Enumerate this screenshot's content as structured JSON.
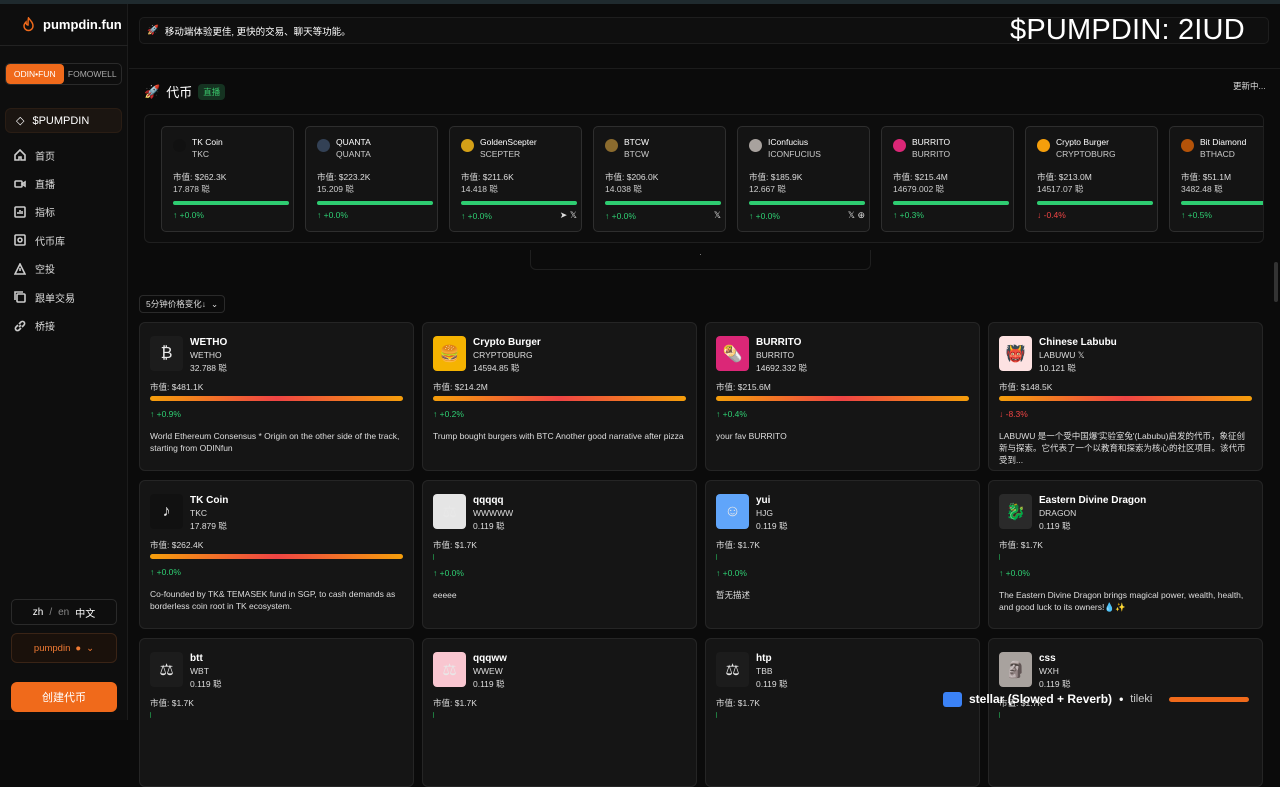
{
  "app": {
    "name": "pumpdin.fun",
    "overlay_text": "$PUMPDIN: 2IUD"
  },
  "sidebar": {
    "tabs": [
      "ODIN•FUN",
      "FOMOWELL"
    ],
    "current_token": "$PUMPDIN",
    "items": [
      {
        "label": "首页",
        "icon": "home-icon"
      },
      {
        "label": "直播",
        "icon": "video-icon"
      },
      {
        "label": "指标",
        "icon": "chart-icon"
      },
      {
        "label": "代币库",
        "icon": "vault-icon"
      },
      {
        "label": "空投",
        "icon": "airdrop-icon"
      },
      {
        "label": "跟单交易",
        "icon": "copy-icon"
      },
      {
        "label": "桥接",
        "icon": "link-icon"
      }
    ],
    "lang": {
      "zh": "zh",
      "sep": "/",
      "en": "en",
      "cn": "中文"
    },
    "user": "pumpdin",
    "create_label": "创建代币"
  },
  "announcement": "移动端体验更佳, 更快的交易、聊天等功能。",
  "section": {
    "title": "代币",
    "live_badge": "直播",
    "updating": "更新中..."
  },
  "ticker": [
    {
      "name": "TK Coin",
      "symbol": "TKC",
      "mcap": "市值: $262.3K",
      "holders": "17.878 聪",
      "change": "↑ +0.0%",
      "dir": "up",
      "color": "#111",
      "social": ""
    },
    {
      "name": "QUANTA",
      "symbol": "QUANTA",
      "mcap": "市值: $223.2K",
      "holders": "15.209 聪",
      "change": "↑ +0.0%",
      "dir": "up",
      "color": "#334155",
      "social": ""
    },
    {
      "name": "GoldenScepter",
      "symbol": "SCEPTER",
      "mcap": "市值: $211.6K",
      "holders": "14.418 聪",
      "change": "↑ +0.0%",
      "dir": "up",
      "color": "#d4a017",
      "social": "➤ 𝕏"
    },
    {
      "name": "BTCW",
      "symbol": "BTCW",
      "mcap": "市值: $206.0K",
      "holders": "14.038 聪",
      "change": "↑ +0.0%",
      "dir": "up",
      "color": "#8b6b2e",
      "social": "𝕏"
    },
    {
      "name": "IConfucius",
      "symbol": "ICONFUCIUS",
      "mcap": "市值: $185.9K",
      "holders": "12.667 聪",
      "change": "↑ +0.0%",
      "dir": "up",
      "color": "#a8a29e",
      "social": "𝕏 ⊕"
    },
    {
      "name": "BURRITO",
      "symbol": "BURRITO",
      "mcap": "市值: $215.4M",
      "holders": "14679.002 聪",
      "change": "↑ +0.3%",
      "dir": "up",
      "color": "#db2777",
      "social": ""
    },
    {
      "name": "Crypto Burger",
      "symbol": "CRYPTOBURG",
      "mcap": "市值: $213.0M",
      "holders": "14517.07 聪",
      "change": "↓ -0.4%",
      "dir": "dn",
      "color": "#f59e0b",
      "social": ""
    },
    {
      "name": "Bit Diamond",
      "symbol": "BTHACD",
      "mcap": "市值: $51.1M",
      "holders": "3482.48 聪",
      "change": "↑ +0.5%",
      "dir": "up",
      "color": "#b45309",
      "social": ""
    }
  ],
  "carousel_dot": "·",
  "sort_label": "5分钟价格变化↓",
  "cards": [
    {
      "name": "WETHO",
      "symbol": "WETHO",
      "holders": "32.788 聪",
      "mcap": "市值: $481.1K",
      "change": "↑ +0.9%",
      "dir": "up",
      "bar": "grad",
      "desc": "World Ethereum Consensus * Origin on the other side of the track, starting from ODINfun",
      "icon": "₿",
      "bg": "#1c1c1c"
    },
    {
      "name": "Crypto Burger",
      "symbol": "CRYPTOBURG",
      "holders": "14594.85 聪",
      "mcap": "市值: $214.2M",
      "change": "↑ +0.2%",
      "dir": "up",
      "bar": "grad",
      "desc": "Trump bought burgers with BTC Another good narrative after pizza",
      "icon": "🍔",
      "bg": "#f5b301"
    },
    {
      "name": "BURRITO",
      "symbol": "BURRITO",
      "holders": "14692.332 聪",
      "mcap": "市值: $215.6M",
      "change": "↑ +0.4%",
      "dir": "up",
      "bar": "grad",
      "desc": "your fav BURRITO",
      "icon": "🌯",
      "bg": "#db2777"
    },
    {
      "name": "Chinese Labubu",
      "symbol": "LABUWU",
      "holders": "10.121 聪",
      "mcap": "市值: $148.5K",
      "change": "↓ -8.3%",
      "dir": "dn",
      "bar": "grad",
      "desc": "LABUWU 是一个受中国爆'实验室兔'(Labubu)启发的代币，象征创新与探索。它代表了一个以教育和探索为核心的社区项目。该代币受到...",
      "icon": "👹",
      "bg": "#fde2e2",
      "x": "𝕏"
    },
    {
      "name": "TK Coin",
      "symbol": "TKC",
      "holders": "17.879 聪",
      "mcap": "市值: $262.4K",
      "change": "↑ +0.0%",
      "dir": "up",
      "bar": "grad",
      "desc": "Co-founded by TK& TEMASEK fund in SGP, to cash demands as borderless coin root in TK ecosystem.",
      "icon": "♪",
      "bg": "#111"
    },
    {
      "name": "qqqqq",
      "symbol": "WWWWW",
      "holders": "0.119 聪",
      "mcap": "市值: $1.7K",
      "change": "↑ +0.0%",
      "dir": "up",
      "bar": "thin",
      "desc": "eeeee",
      "icon": "⚖",
      "bg": "#e5e5e5"
    },
    {
      "name": "yui",
      "symbol": "HJG",
      "holders": "0.119 聪",
      "mcap": "市值: $1.7K",
      "change": "↑ +0.0%",
      "dir": "up",
      "bar": "thin",
      "desc": "暂无描述",
      "icon": "☺",
      "bg": "#60a5fa"
    },
    {
      "name": "Eastern Divine Dragon",
      "symbol": "DRAGON",
      "holders": "0.119 聪",
      "mcap": "市值: $1.7K",
      "change": "↑ +0.0%",
      "dir": "up",
      "bar": "thin",
      "desc": "The Eastern Divine Dragon brings magical power, wealth, health, and good luck to its owners!💧✨",
      "icon": "🐉",
      "bg": "#2a2a2a"
    },
    {
      "name": "btt",
      "symbol": "WBT",
      "holders": "0.119 聪",
      "mcap": "市值: $1.7K",
      "change": "",
      "dir": "up",
      "bar": "thin",
      "desc": "",
      "icon": "⚖",
      "bg": "#1c1c1c"
    },
    {
      "name": "qqqww",
      "symbol": "WWEW",
      "holders": "0.119 聪",
      "mcap": "市值: $1.7K",
      "change": "",
      "dir": "up",
      "bar": "thin",
      "desc": "",
      "icon": "⚖",
      "bg": "#f9c6d0"
    },
    {
      "name": "htp",
      "symbol": "TBB",
      "holders": "0.119 聪",
      "mcap": "市值: $1.7K",
      "change": "",
      "dir": "up",
      "bar": "thin",
      "desc": "",
      "icon": "⚖",
      "bg": "#1c1c1c"
    },
    {
      "name": "css",
      "symbol": "WXH",
      "holders": "0.119 聪",
      "mcap": "市值: $1.7K",
      "change": "",
      "dir": "up",
      "bar": "thin",
      "desc": "",
      "icon": "🗿",
      "bg": "#a8a29e"
    }
  ],
  "player": {
    "title": "stellar (Slowed + Reverb)",
    "sep": "•",
    "artist": "tileki"
  }
}
